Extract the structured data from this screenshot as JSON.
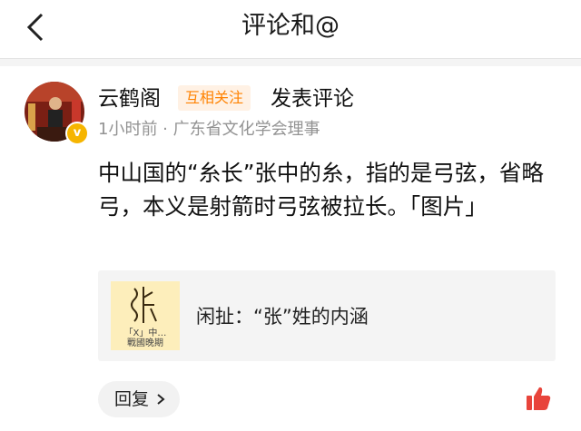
{
  "header": {
    "title": "评论和@"
  },
  "comment": {
    "author": "云鹤阁",
    "mutual_tag": "互相关注",
    "action": "发表评论",
    "meta": "1小时前 · 广东省文化学会理事",
    "text": "中山国的“糸长”张中的糸，指的是弓弦，省略弓，本义是射箭时弓弦被拉长。「图片」",
    "link_card": {
      "title": "闲扯：“张”姓的内涵",
      "thumb_caption": "「X」中…",
      "thumb_sub": "戰國晚期"
    },
    "reply_label": "回复"
  },
  "icons": {
    "back": "back-chevron-icon",
    "verified": "verified-badge-icon",
    "reply_arrow": "chevron-right-icon",
    "like": "thumbs-up-icon"
  },
  "colors": {
    "accent": "#ff8200",
    "mutual_bg": "#fff1e4",
    "like": "#e8443b",
    "verified": "#f6b500",
    "meta_gray": "#939393"
  }
}
